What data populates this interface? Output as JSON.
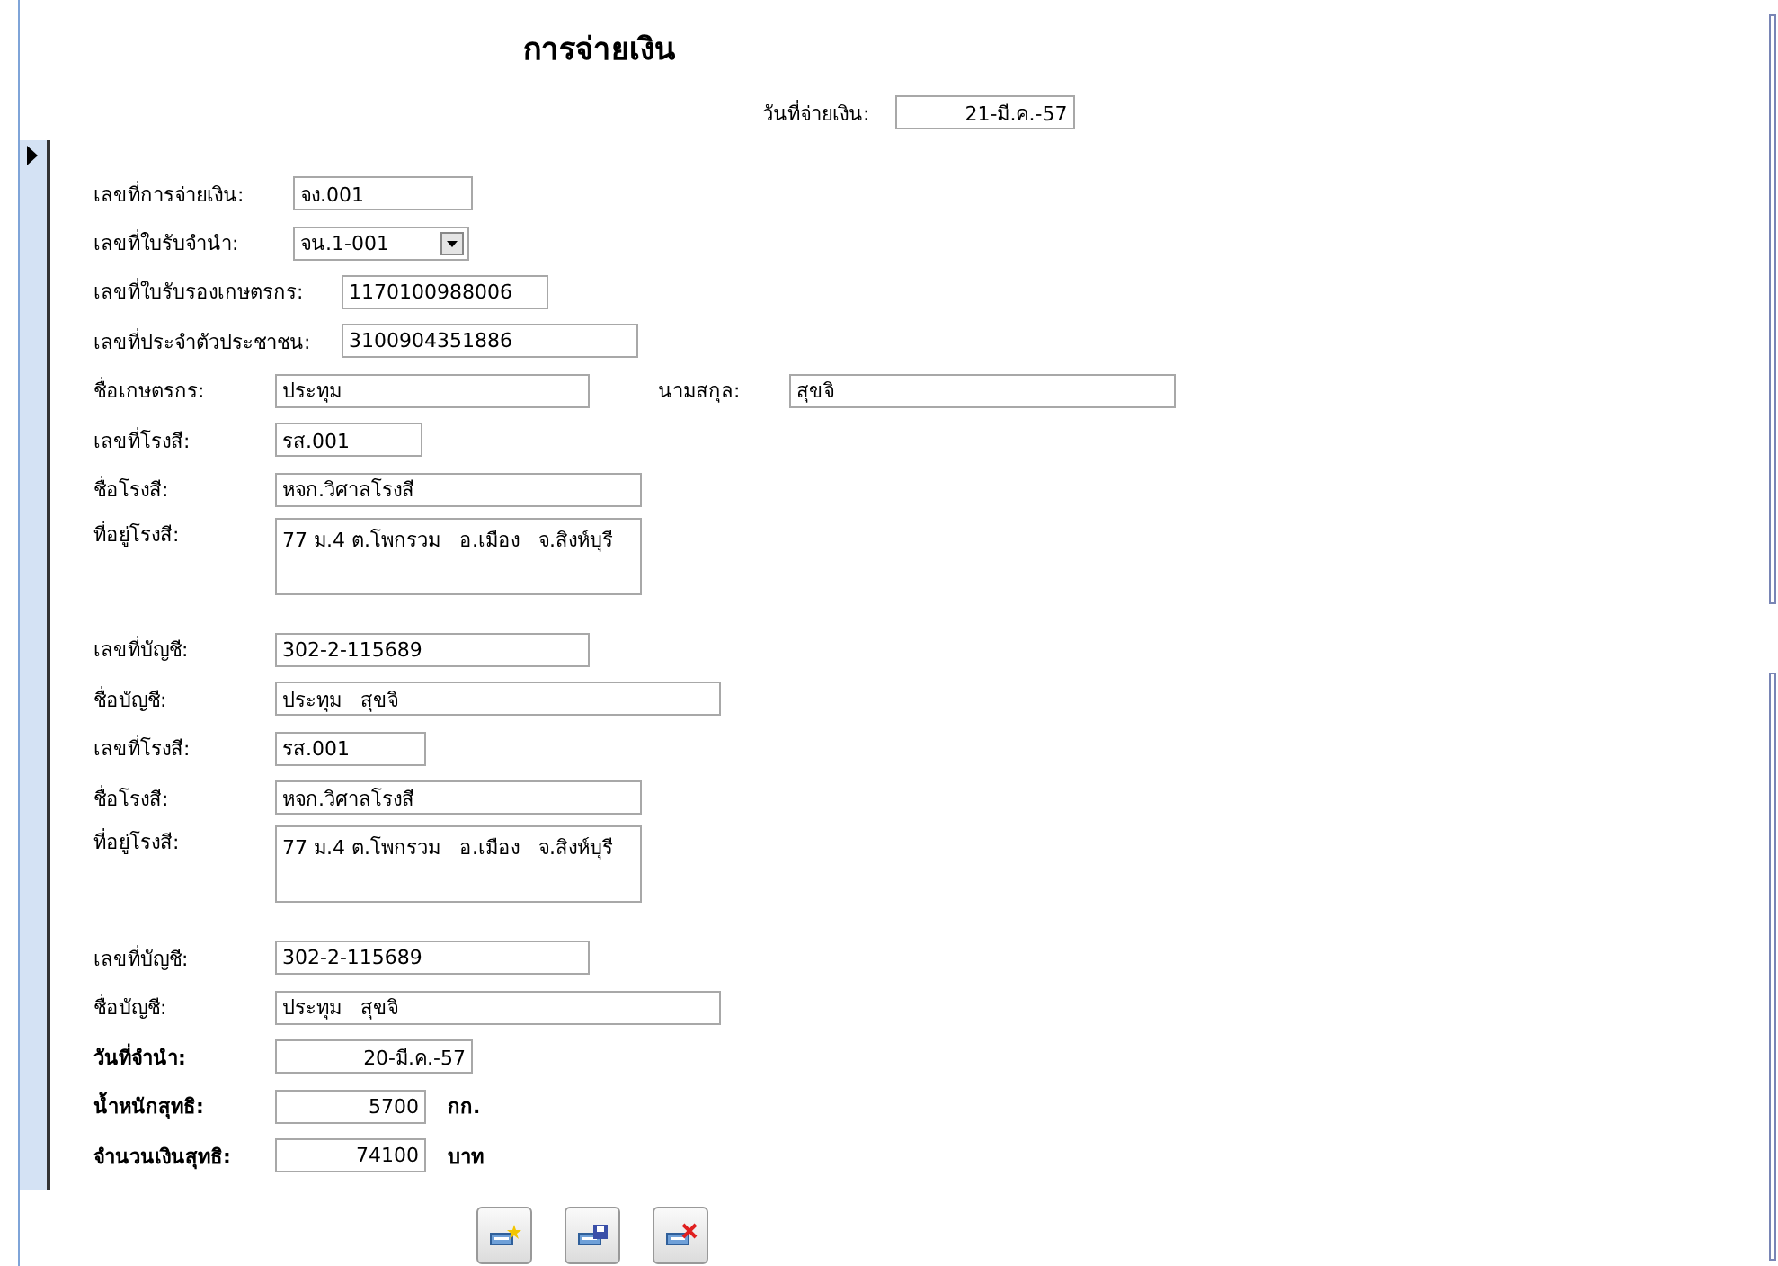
{
  "form": {
    "title": "การจ่ายเงิน",
    "payment_date": {
      "label": "วันที่จ่ายเงิน:",
      "value": "21-มี.ค.-57"
    },
    "rows": [
      {
        "kind": "text",
        "label": "เลขที่การจ่ายเงิน:",
        "value": "จง.001"
      },
      {
        "kind": "combo",
        "label": "เลขที่ใบรับจำนำ:",
        "value": "จน.1-001"
      },
      {
        "kind": "text",
        "label": "เลขที่ใบรับรองเกษตรกร:",
        "value": "1170100988006"
      },
      {
        "kind": "text",
        "label": "เลขที่ประจำตัวประชาชน:",
        "value": "3100904351886"
      },
      {
        "kind": "pair",
        "label": "ชื่อเกษตรกร:",
        "value": "ประทุม",
        "label2": "นามสกุล:",
        "value2": "สุขจิ"
      },
      {
        "kind": "text",
        "label": "เลขที่โรงสี:",
        "value": "รส.001"
      },
      {
        "kind": "text",
        "label": "ชื่อโรงสี:",
        "value": "หจก.วิศาลโรงสี"
      },
      {
        "kind": "area",
        "label": "ที่อยู่โรงสี:",
        "value": "77 ม.4 ต.โพกรวม   อ.เมือง   จ.สิงห์บุรี"
      },
      {
        "kind": "text",
        "label": "เลขที่บัญชี:",
        "value": "302-2-115689"
      },
      {
        "kind": "text",
        "label": "ชื่อบัญชี:",
        "value": "ประทุม   สุขจิ"
      },
      {
        "kind": "text",
        "label": "เลขที่โรงสี:",
        "value": "รส.001"
      },
      {
        "kind": "text",
        "label": "ชื่อโรงสี:",
        "value": "หจก.วิศาลโรงสี"
      },
      {
        "kind": "area",
        "label": "ที่อยู่โรงสี:",
        "value": "77 ม.4 ต.โพกรวม   อ.เมือง   จ.สิงห์บุรี"
      },
      {
        "kind": "text",
        "label": "เลขที่บัญชี:",
        "value": "302-2-115689"
      },
      {
        "kind": "text",
        "label": "ชื่อบัญชี:",
        "value": "ประทุม   สุขจิ"
      },
      {
        "kind": "number",
        "label": "วันที่จำนำ:",
        "value": "20-มี.ค.-57"
      },
      {
        "kind": "number",
        "label": "น้ำหนักสุทธิ:",
        "value": "5700",
        "unit": "กก."
      },
      {
        "kind": "number",
        "label": "จำนวนเงินสุทธิ:",
        "value": "74100",
        "unit": "บาท"
      }
    ]
  },
  "buttons": [
    {
      "kind": "new"
    },
    {
      "kind": "save"
    },
    {
      "kind": "delete"
    }
  ]
}
